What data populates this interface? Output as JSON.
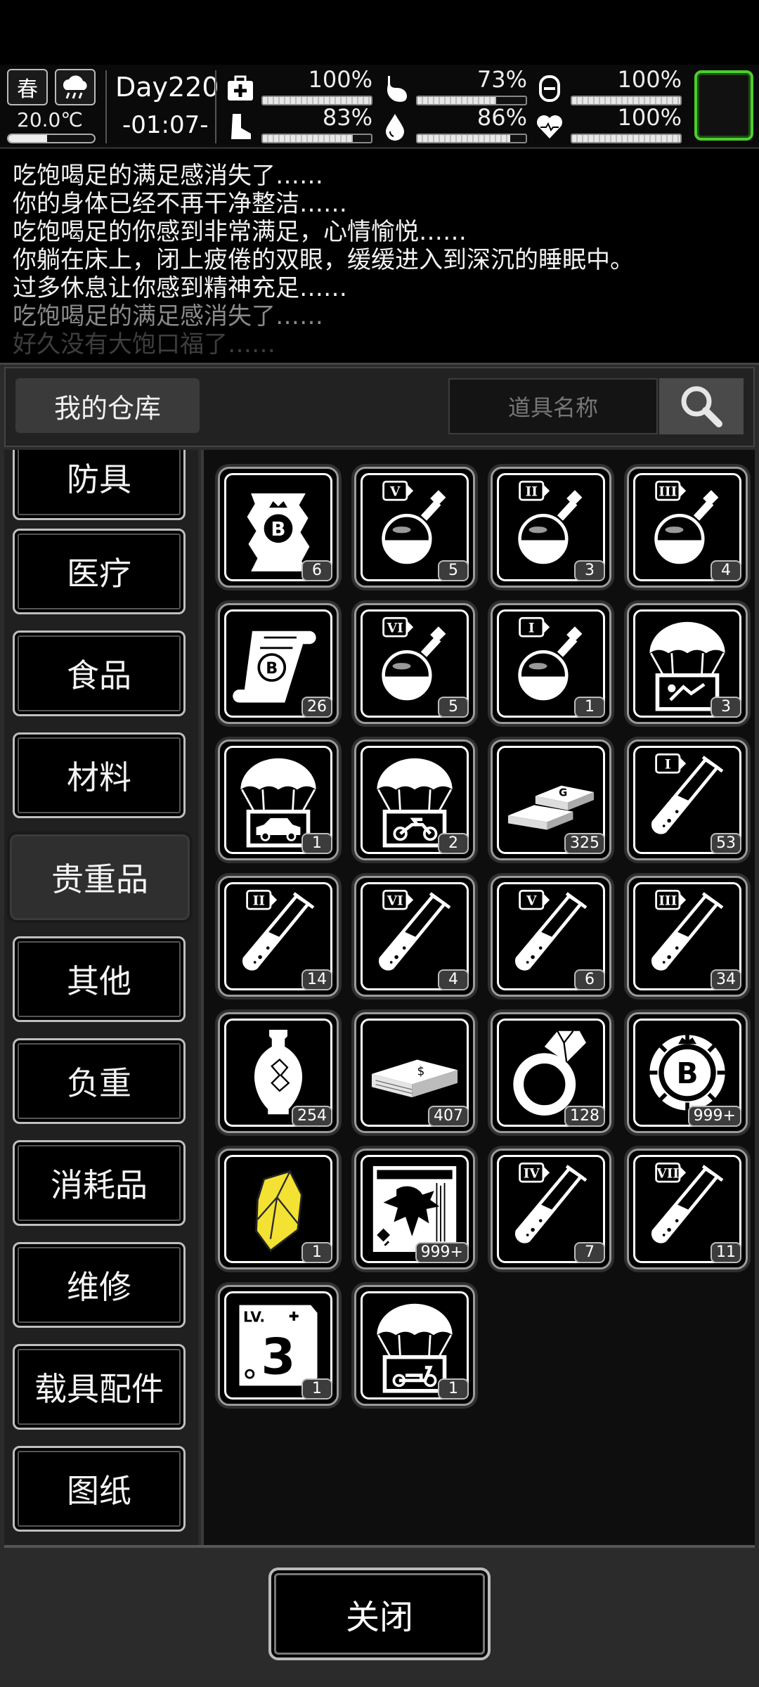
{
  "status": {
    "season": "春",
    "day": "Day220",
    "time": "-01:07-",
    "temperature": "20.0℃",
    "temperature_level": 0.45,
    "stats": [
      {
        "icon": "medkit-icon",
        "value": "100%",
        "level": 1.0
      },
      {
        "icon": "stomach-icon",
        "value": "73%",
        "level": 0.73
      },
      {
        "icon": "energy-icon",
        "value": "100%",
        "level": 1.0
      },
      {
        "icon": "boot-icon",
        "value": "83%",
        "level": 0.83
      },
      {
        "icon": "water-drop-icon",
        "value": "86%",
        "level": 0.86
      },
      {
        "icon": "heart-icon",
        "value": "100%",
        "level": 1.0
      }
    ]
  },
  "log": [
    "吃饱喝足的满足感消失了……",
    "你的身体已经不再干净整洁……",
    "吃饱喝足的你感到非常满足，心情愉悦……",
    "你躺在床上，闭上疲倦的双眼，缓缓进入到深沉的睡眠中。",
    "过多休息让你感到精神充足……",
    "吃饱喝足的满足感消失了……",
    "好久没有大饱口福了……"
  ],
  "header": {
    "title": "我的仓库",
    "search_placeholder": "道具名称"
  },
  "categories": [
    "防具",
    "医疗",
    "食品",
    "材料",
    "贵重品",
    "其他",
    "负重",
    "消耗品",
    "维修",
    "载具配件",
    "图纸"
  ],
  "selected_category": "贵重品",
  "items": [
    {
      "icon": "bitcoin-map-icon",
      "qty": "6"
    },
    {
      "icon": "potion-v-icon",
      "qty": "5"
    },
    {
      "icon": "potion-ii-icon",
      "qty": "3"
    },
    {
      "icon": "potion-iii-icon",
      "qty": "4"
    },
    {
      "icon": "bitcoin-scroll-icon",
      "qty": "26"
    },
    {
      "icon": "potion-vi-icon",
      "qty": "5"
    },
    {
      "icon": "potion-i-icon",
      "qty": "1"
    },
    {
      "icon": "airdrop-crate-icon",
      "qty": "3"
    },
    {
      "icon": "airdrop-car-icon",
      "qty": "1"
    },
    {
      "icon": "airdrop-motorcycle-icon",
      "qty": "2"
    },
    {
      "icon": "gold-bars-icon",
      "qty": "325"
    },
    {
      "icon": "test-tube-i-icon",
      "qty": "53"
    },
    {
      "icon": "test-tube-ii-icon",
      "qty": "14"
    },
    {
      "icon": "test-tube-vi-icon",
      "qty": "4"
    },
    {
      "icon": "test-tube-v-icon",
      "qty": "6"
    },
    {
      "icon": "test-tube-iii-icon",
      "qty": "34"
    },
    {
      "icon": "vase-icon",
      "qty": "254"
    },
    {
      "icon": "cash-stack-icon",
      "qty": "407"
    },
    {
      "icon": "diamond-ring-icon",
      "qty": "128"
    },
    {
      "icon": "bitcoin-chip-icon",
      "qty": "999+"
    },
    {
      "icon": "yellow-crystal-icon",
      "qty": "1"
    },
    {
      "icon": "zombie-poster-icon",
      "qty": "999+"
    },
    {
      "icon": "test-tube-iv-icon",
      "qty": "7"
    },
    {
      "icon": "test-tube-vii-icon",
      "qty": "11"
    },
    {
      "icon": "level-3-card-icon",
      "qty": "1"
    },
    {
      "icon": "airdrop-scooter-icon",
      "qty": "1"
    }
  ],
  "footer": {
    "close_label": "关闭"
  }
}
